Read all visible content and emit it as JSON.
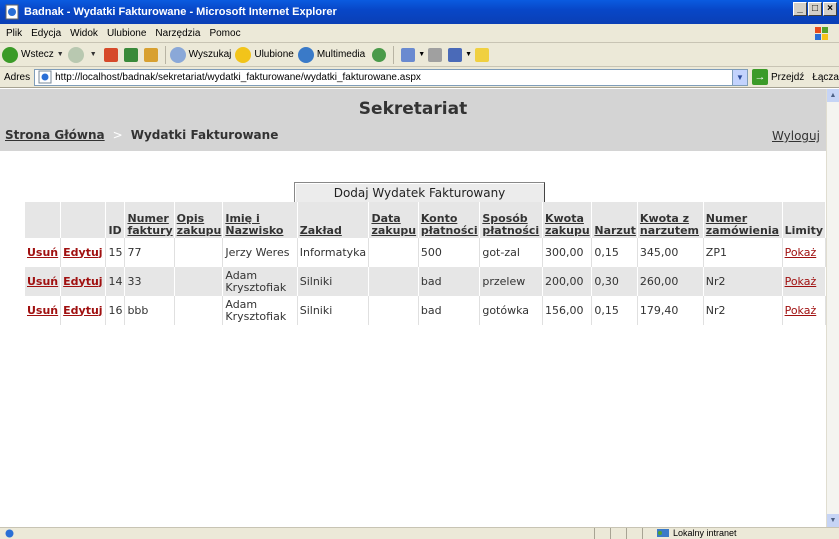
{
  "window": {
    "title": "Badnak - Wydatki Fakturowane - Microsoft Internet Explorer"
  },
  "menu": [
    "Plik",
    "Edycja",
    "Widok",
    "Ulubione",
    "Narzędzia",
    "Pomoc"
  ],
  "toolbar": {
    "back": "Wstecz",
    "search": "Wyszukaj",
    "favorites": "Ulubione",
    "multimedia": "Multimedia"
  },
  "address": {
    "label": "Adres",
    "url": "http://localhost/badnak/sekretariat/wydatki_fakturowane/wydatki_fakturowane.aspx",
    "go": "Przejdź",
    "links": "Łącza"
  },
  "page": {
    "heading": "Sekretariat",
    "breadcrumb": {
      "home": "Strona Główna",
      "separator": ">",
      "current": "Wydatki Fakturowane"
    },
    "logout": "Wyloguj",
    "add_button": "Dodaj Wydatek Fakturowany"
  },
  "table": {
    "headers": [
      "",
      "",
      "ID",
      "Numer faktury",
      "Opis zakupu",
      "Imię i Nazwisko",
      "Zakład",
      "Data zakupu",
      "Konto płatności",
      "Sposób płatności",
      "Kwota zakupu",
      "Narzut",
      "Kwota z narzutem",
      "Numer zamówienia",
      "Limity"
    ],
    "rows": [
      {
        "delete": "Usuń",
        "edit": "Edytuj",
        "id": "15",
        "invoice": "77",
        "desc": "",
        "name": "Jerzy Weres",
        "dept": "Informatyka",
        "date": "",
        "account": "500",
        "payment": "got-zal",
        "amount": "300,00",
        "markup": "0,15",
        "total": "345,00",
        "order": "ZP1",
        "limits": "Pokaż"
      },
      {
        "delete": "Usuń",
        "edit": "Edytuj",
        "id": "14",
        "invoice": "33",
        "desc": "",
        "name": "Adam Krysztofiak",
        "dept": "Silniki",
        "date": "",
        "account": "bad",
        "payment": "przelew",
        "amount": "200,00",
        "markup": "0,30",
        "total": "260,00",
        "order": "Nr2",
        "limits": "Pokaż"
      },
      {
        "delete": "Usuń",
        "edit": "Edytuj",
        "id": "16",
        "invoice": "bbb",
        "desc": "",
        "name": "Adam Krysztofiak",
        "dept": "Silniki",
        "date": "",
        "account": "bad",
        "payment": "gotówka",
        "amount": "156,00",
        "markup": "0,15",
        "total": "179,40",
        "order": "Nr2",
        "limits": "Pokaż"
      }
    ]
  },
  "status": {
    "zone": "Lokalny intranet"
  },
  "colors": {
    "titlebar": "#0a5be0",
    "header_bg": "#d4d4d4",
    "link_red": "#a01010",
    "row_alt": "#e6e6e6"
  }
}
